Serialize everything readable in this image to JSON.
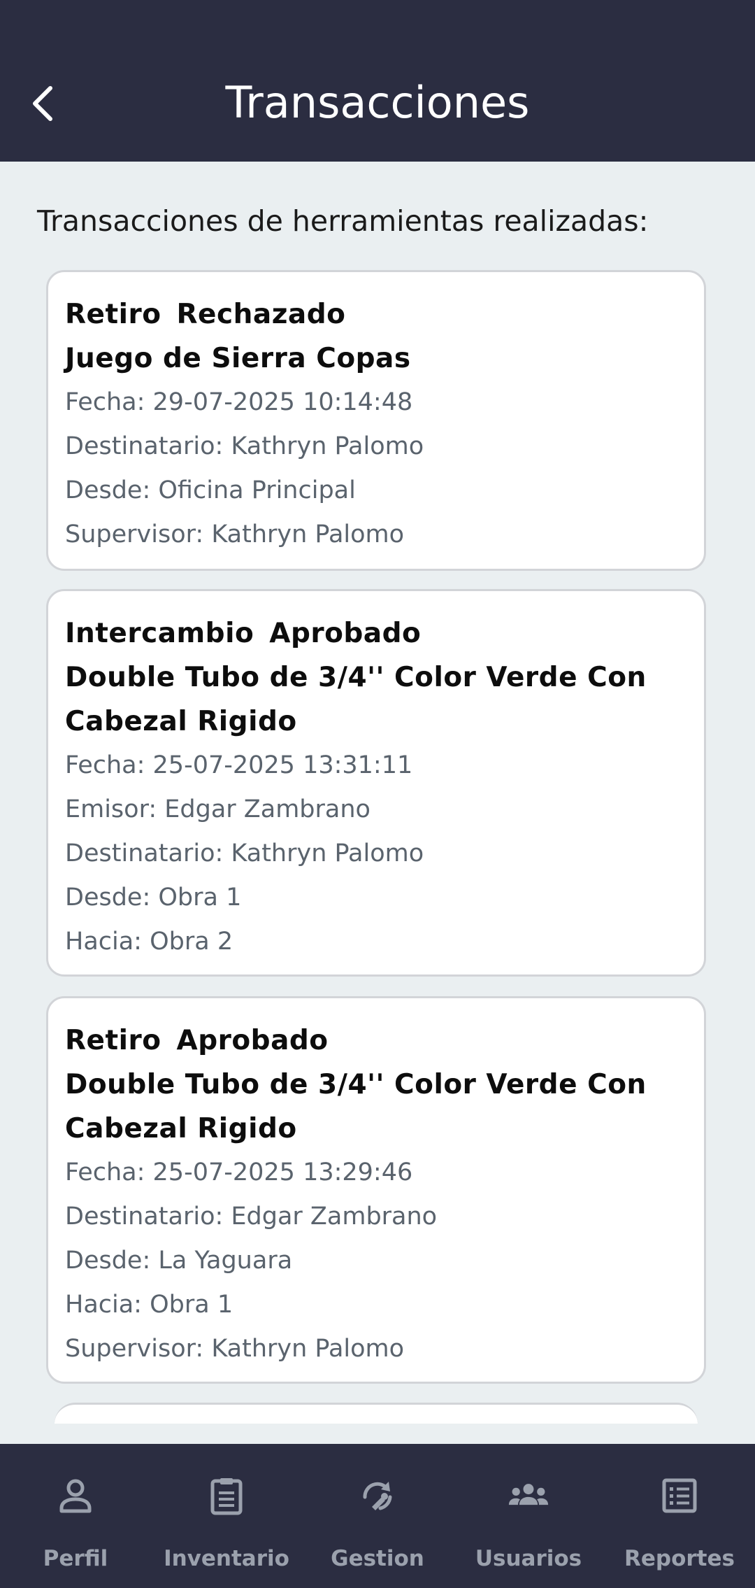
{
  "header": {
    "title": "Transacciones"
  },
  "subtitle": "Transacciones de herramientas realizadas:",
  "transactions": [
    {
      "type": "Retiro",
      "status": "Rechazado",
      "tool": "Juego de Sierra Copas",
      "lines": [
        "Fecha: 29-07-2025 10:14:48",
        "Destinatario: Kathryn Palomo",
        "Desde: Oficina Principal",
        "Supervisor: Kathryn Palomo"
      ]
    },
    {
      "type": "Intercambio",
      "status": "Aprobado",
      "tool": "Double Tubo de 3/4'' Color Verde Con Cabezal Rigido",
      "lines": [
        "Fecha: 25-07-2025 13:31:11",
        "Emisor: Edgar Zambrano",
        "Destinatario: Kathryn Palomo",
        "Desde: Obra 1",
        "Hacia: Obra 2"
      ]
    },
    {
      "type": "Retiro",
      "status": "Aprobado",
      "tool": "Double Tubo de 3/4'' Color Verde Con Cabezal Rigido",
      "lines": [
        "Fecha: 25-07-2025 13:29:46",
        "Destinatario: Edgar Zambrano",
        "Desde: La Yaguara",
        "Hacia: Obra 1",
        "Supervisor: Kathryn Palomo"
      ]
    }
  ],
  "nav": {
    "items": [
      {
        "label": "Perfil",
        "icon": "person-icon"
      },
      {
        "label": "Inventario",
        "icon": "clipboard-icon"
      },
      {
        "label": "Gestion",
        "icon": "sync-tool-icon"
      },
      {
        "label": "Usuarios",
        "icon": "group-icon"
      },
      {
        "label": "Reportes",
        "icon": "list-report-icon"
      }
    ]
  },
  "colors": {
    "header_bg": "#2b2d41",
    "page_bg": "#eaeff1",
    "card_border": "#d2d4d8",
    "secondary_text": "#5a636d",
    "nav_label": "#9ba1ad"
  }
}
